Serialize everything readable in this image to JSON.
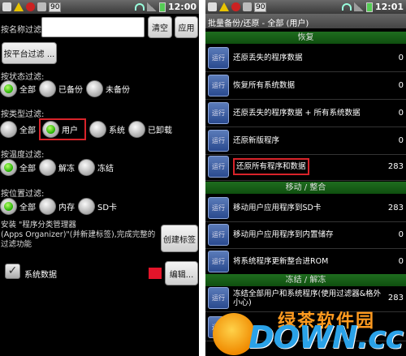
{
  "left": {
    "status": {
      "badge_num": "90",
      "time": "12:00"
    },
    "filter_name_label": "按名称过滤:",
    "filter_input_value": "",
    "clear_btn": "清空",
    "apply_btn": "应用",
    "platform_filter_btn": "按平台过滤 ...",
    "status_filter": {
      "label": "按状态过滤:",
      "options": [
        "全部",
        "已备份",
        "未备份"
      ],
      "selected": "全部"
    },
    "type_filter": {
      "label": "按类型过滤:",
      "options": [
        "全部",
        "用户",
        "系统",
        "已卸载"
      ],
      "selected": "用户"
    },
    "temp_filter": {
      "label": "按温度过滤:",
      "options": [
        "全部",
        "解冻",
        "冻结"
      ],
      "selected": "全部"
    },
    "location_filter": {
      "label": "按位置过滤:",
      "options": [
        "全部",
        "内存",
        "SD卡"
      ],
      "selected": "全部"
    },
    "install_note": "安装 \"程序分类管理器\n(Apps Organizer)\"(并新建标签),完成完整的过滤功能",
    "create_tag_btn": "创建标签",
    "system_data_label": "系统数据",
    "edit_btn": "编辑...",
    "colors": {
      "selected_radio": "#22b000",
      "highlight": "#d8232a"
    }
  },
  "right": {
    "status": {
      "badge_num": "90",
      "time": "12:01"
    },
    "title": "批量备份/还原 - 全部 (用户)",
    "sections": [
      {
        "name": "恢复",
        "rows": [
          {
            "run": "运行",
            "label": "还原丢失的程序数据",
            "count": "0"
          },
          {
            "run": "运行",
            "label": "恢复所有系统数据",
            "count": "0"
          },
          {
            "run": "运行",
            "label": "还原丢失的程序数据 + 所有系统数据",
            "count": "0"
          },
          {
            "run": "运行",
            "label": "还原新版程序",
            "count": "0"
          },
          {
            "run": "运行",
            "label": "还原所有程序和数据",
            "count": "283"
          }
        ]
      },
      {
        "name": "移动 / 整合",
        "rows": [
          {
            "run": "运行",
            "label": "移动用户应用程序到SD卡",
            "count": "283"
          },
          {
            "run": "运行",
            "label": "移动用户应用程序到内置储存",
            "count": "0"
          },
          {
            "run": "运行",
            "label": "将系统程序更新整合进ROM",
            "count": "0"
          }
        ]
      },
      {
        "name": "冻结 / 解冻",
        "rows": [
          {
            "run": "运行",
            "label": "冻结全部用户和系统程序(使用过滤器&格外小心)",
            "count": "283"
          },
          {
            "run": "运行",
            "label": "解冻",
            "count": ""
          }
        ]
      }
    ],
    "colors": {
      "section_bg": "#1f6d1f",
      "run_btn": "#2a4a8f"
    }
  },
  "watermark": {
    "top": "绿茶软件园",
    "main": "DOWN.cc"
  }
}
